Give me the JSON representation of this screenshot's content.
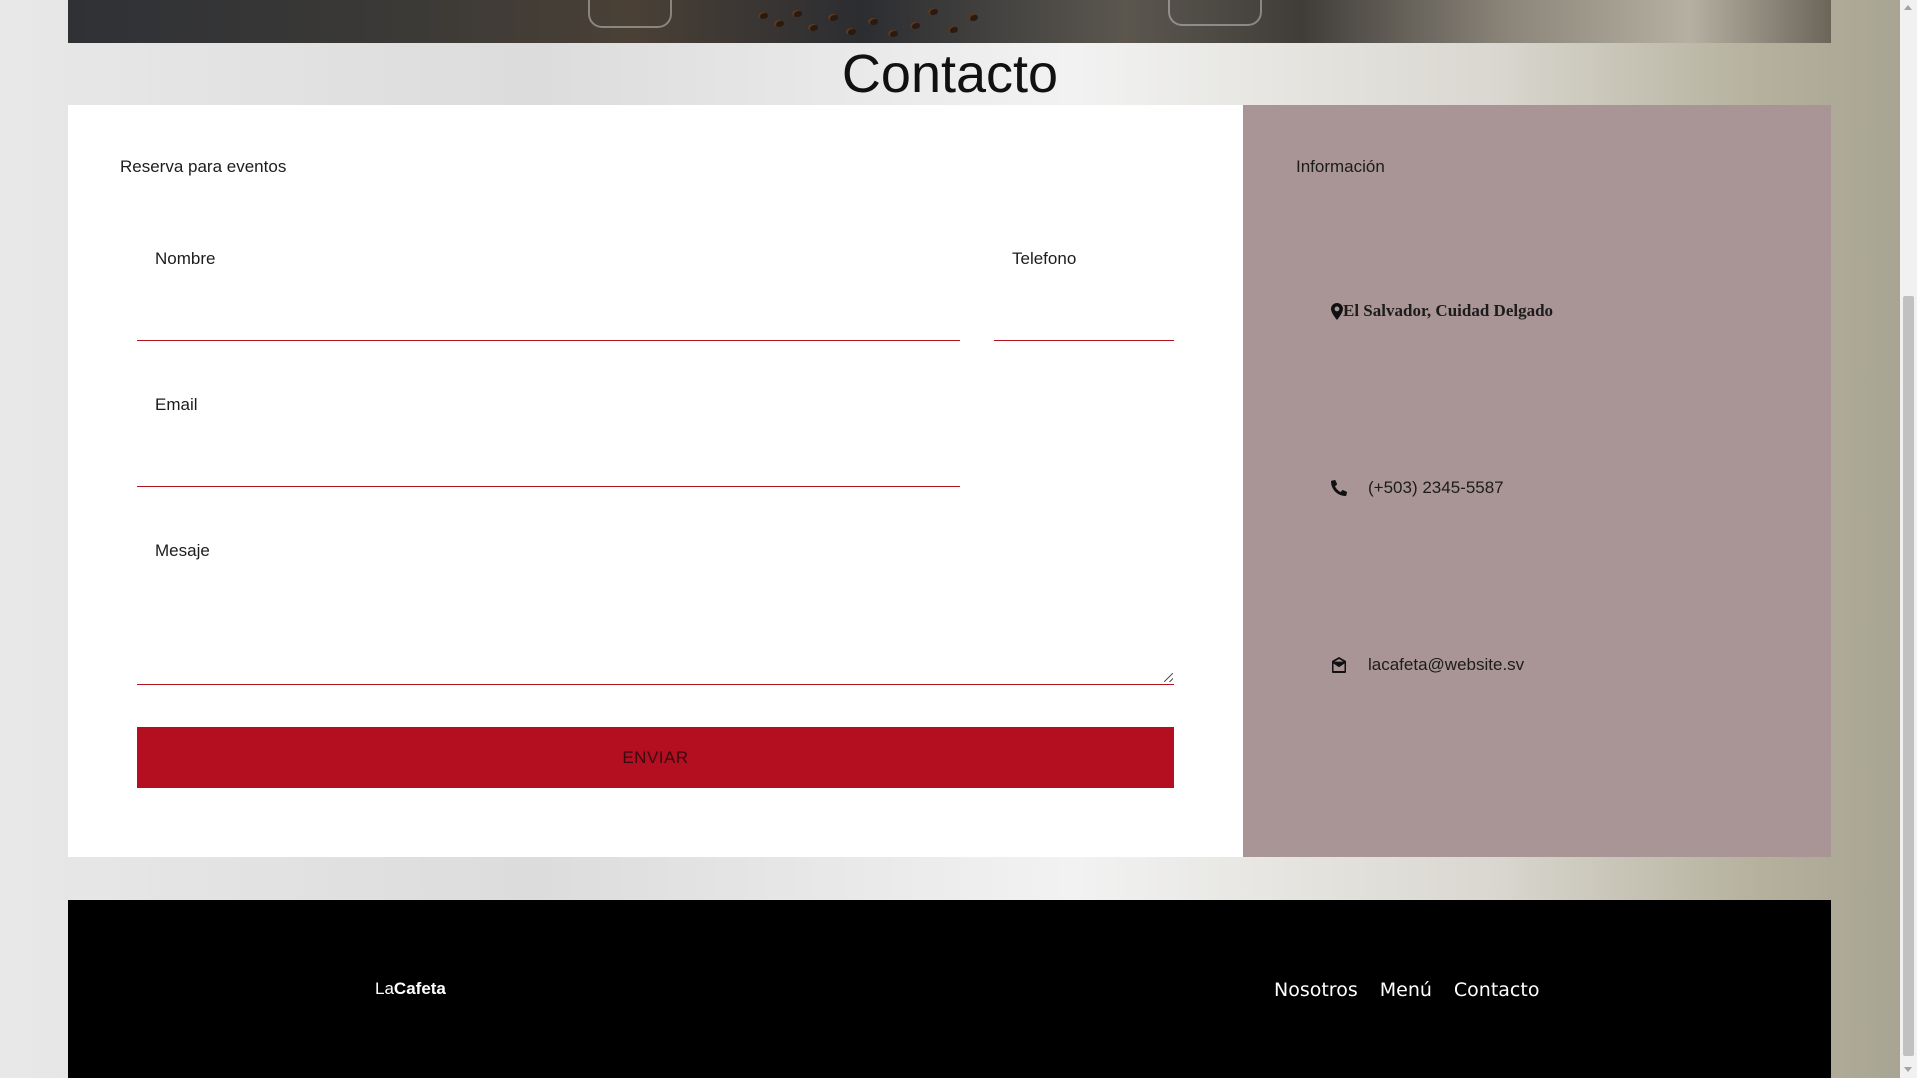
{
  "page": {
    "title": "Contacto"
  },
  "form": {
    "heading": "Reserva para eventos",
    "name_label": "Nombre",
    "phone_label": "Telefono",
    "email_label": "Email",
    "message_label": "Mesaje",
    "name_value": "",
    "phone_value": "",
    "email_value": "",
    "message_value": "",
    "submit_label": "ENVIAR"
  },
  "info": {
    "heading": "Información",
    "address": "El Salvador, Cuidad Delgado",
    "phone": "(+503) 2345-5587",
    "email": "lacafeta@website.sv",
    "icons": [
      "map-marker-icon",
      "phone-icon",
      "envelope-open-icon"
    ]
  },
  "footer": {
    "brand_prefix": "La",
    "brand_bold": "Cafeta",
    "nav": [
      "Nosotros",
      "Menú",
      "Contacto"
    ]
  },
  "colors": {
    "accent_red": "#b40e21",
    "info_panel": "#a99596",
    "footer": "#000000"
  }
}
